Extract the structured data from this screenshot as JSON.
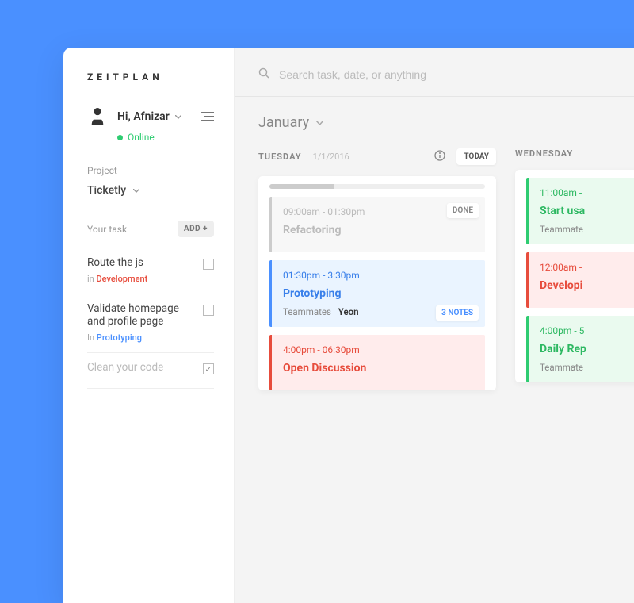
{
  "brand": "ZEITPLAN",
  "user": {
    "greeting": "Hi, Afnizar",
    "status": "Online"
  },
  "project": {
    "label": "Project",
    "name": "Ticketly"
  },
  "tasks": {
    "label": "Your task",
    "add_label": "ADD +",
    "items": [
      {
        "title": "Route the js",
        "meta_prefix": "in ",
        "category": "Development",
        "cat_class": "cat-dev",
        "done": false
      },
      {
        "title": "Validate homepage and profile page",
        "meta_prefix": "In ",
        "category": "Prototyping",
        "cat_class": "cat-proto",
        "done": false
      },
      {
        "title": "Clean your code",
        "meta_prefix": "",
        "category": "",
        "cat_class": "",
        "done": true
      }
    ]
  },
  "search": {
    "placeholder": "Search task, date, or anything"
  },
  "month": "January",
  "days": [
    {
      "name": "TUESDAY",
      "date": "1/1/2016",
      "today": "TODAY",
      "progress_pct": 30,
      "cards": [
        {
          "time": "09:00am - 01:30pm",
          "title": "Refactoring",
          "team_label": "",
          "team_names": "",
          "color": "c-gray",
          "badge_top": "DONE",
          "badge_bottom": ""
        },
        {
          "time": "01:30pm - 3:30pm",
          "title": "Prototyping",
          "team_label": "Teammates",
          "team_names": "Yeon",
          "color": "c-blue",
          "badge_top": "",
          "badge_bottom": "3 NOTES"
        },
        {
          "time": "4:00pm - 06:30pm",
          "title": "Open Discussion",
          "team_label": "",
          "team_names": "",
          "color": "c-red",
          "badge_top": "",
          "badge_bottom": ""
        }
      ]
    },
    {
      "name": "WEDNESDAY",
      "date": "",
      "today": "",
      "progress_pct": 0,
      "cards": [
        {
          "time": "11:00am - ",
          "title": "Start usa",
          "team_label": "Teammate",
          "team_names": "",
          "color": "c-green",
          "badge_top": "",
          "badge_bottom": ""
        },
        {
          "time": "12:00am - ",
          "title": "Developi",
          "team_label": "",
          "team_names": "",
          "color": "c-red",
          "badge_top": "",
          "badge_bottom": ""
        },
        {
          "time": "4:00pm - 5",
          "title": "Daily Rep",
          "team_label": "Teammate",
          "team_names": "",
          "color": "c-green",
          "badge_top": "",
          "badge_bottom": ""
        }
      ]
    }
  ]
}
